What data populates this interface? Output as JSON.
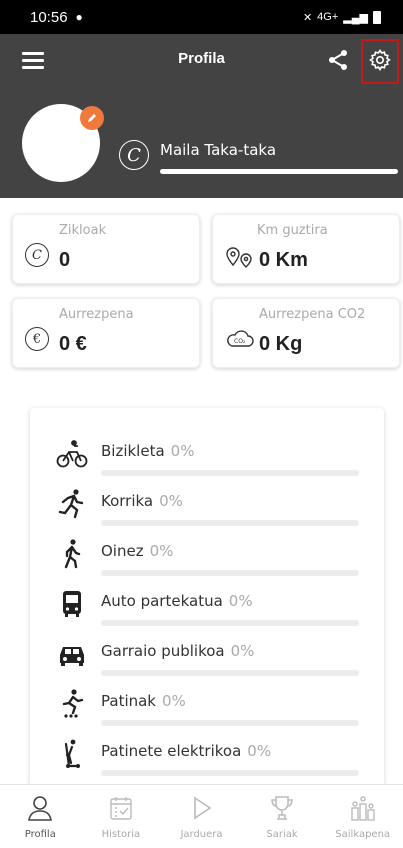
{
  "status_bar": {
    "time": "10:56",
    "network": "4G+"
  },
  "header": {
    "title": "Profila"
  },
  "profile": {
    "level_label": "Maila Taka-taka"
  },
  "stats": [
    {
      "label": "Zikloak",
      "value": "0",
      "icon": "cycle-coin-icon"
    },
    {
      "label": "Km guztira",
      "value": "0 Km",
      "icon": "map-pins-icon"
    },
    {
      "label": "Aurrezpena",
      "value": "0 €",
      "icon": "euro-icon"
    },
    {
      "label": "Aurrezpena CO2",
      "value": "0 Kg",
      "icon": "co2-cloud-icon"
    }
  ],
  "activities": [
    {
      "name": "Bizikleta",
      "percent": "0%",
      "icon": "bicycle-icon"
    },
    {
      "name": "Korrika",
      "percent": "0%",
      "icon": "running-icon"
    },
    {
      "name": "Oinez",
      "percent": "0%",
      "icon": "walking-icon"
    },
    {
      "name": "Auto partekatua",
      "percent": "0%",
      "icon": "bus-icon"
    },
    {
      "name": "Garraio publikoa",
      "percent": "0%",
      "icon": "car-icon"
    },
    {
      "name": "Patinak",
      "percent": "0%",
      "icon": "skates-icon"
    },
    {
      "name": "Patinete elektrikoa",
      "percent": "0%",
      "icon": "scooter-icon"
    }
  ],
  "bottom_nav": [
    {
      "label": "Profila",
      "icon": "person-icon",
      "active": true
    },
    {
      "label": "Historia",
      "icon": "calendar-icon",
      "active": false
    },
    {
      "label": "Jarduera",
      "icon": "play-icon",
      "active": false
    },
    {
      "label": "Sariak",
      "icon": "trophy-icon",
      "active": false
    },
    {
      "label": "Sailkapena",
      "icon": "ranking-icon",
      "active": false
    }
  ],
  "colors": {
    "header_bg": "#434343",
    "accent_orange": "#f07a3c",
    "highlight_red": "#c01a1a"
  }
}
